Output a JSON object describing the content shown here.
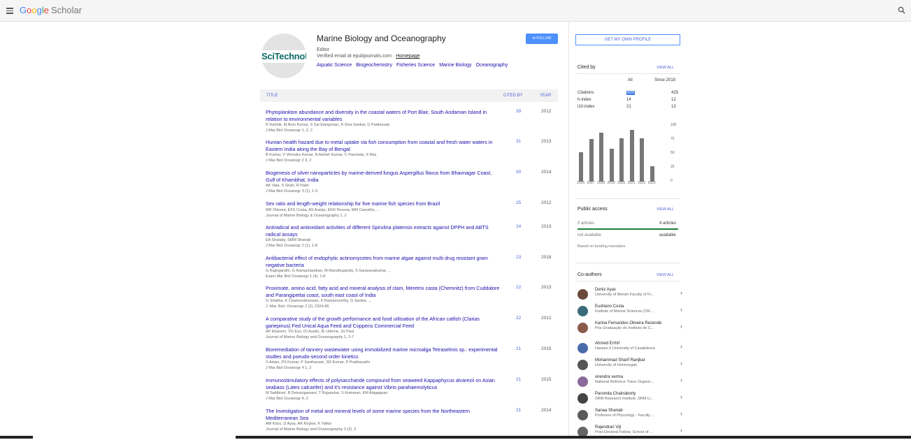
{
  "header": {
    "brand1": "G",
    "brand2": "o",
    "brand3": "o",
    "brand4": "g",
    "brand5": "l",
    "brand6": "e",
    "brand_suffix": "Scholar"
  },
  "profile": {
    "logo_text": "SciTechnol",
    "name": "Marine Biology and Oceanography",
    "role": "Editor",
    "email": "Verified email at epubjournals.com",
    "homepage": "Homepage",
    "tags": [
      "Aquatic Science",
      "Biogeochemistry",
      "Fisheries Science",
      "Marine Biology",
      "Oceanography"
    ],
    "follow_label": "FOLLOW"
  },
  "table": {
    "headers": {
      "title": "TITLE",
      "cited_by": "CITED BY",
      "year": "YEAR"
    },
    "rows": [
      {
        "title": "Phytoplankton abundance and diversity in the coastal waters of Port Blair, South Andaman Island in relation to environmental variables",
        "authors": "R Karthik, M Arun Kumar, S Sai Elangovan, R Siva Sankar, G Padmavati",
        "journal": "J Mar Biol Oceanogr 1, 2, 2",
        "cited": "39",
        "year": "2012"
      },
      {
        "title": "Human health hazard due to metal uptake via fish consumption from coastal and fresh water waters in Eastern India along the Bay of Bengal",
        "authors": "B Kumar, V Virendra Kumar, N Ashish Kumar, C Paromita, S Rita",
        "journal": "J Mar Biol Oceanogr 2 3, 2",
        "cited": "31",
        "year": "2013"
      },
      {
        "title": "Biogenesis of silver nanoparticles by marine-derived fungus Aspergillus flavus from Bhavnagar Coast, Gulf of Khambhat, India",
        "authors": "AK Vala, S Shah, R Patel",
        "journal": "J Mar Biol Oceanogr 3 (1), 1-3",
        "cited": "30",
        "year": "2014"
      },
      {
        "title": "Sex ratio and length-weight relationship for five marine fish species from Brazil",
        "authors": "MR Oliveira, EFS Costa, AS Araújo, EKR Pessoa, MM Carvalho, ...",
        "journal": "Journal of Marine Biology & Oceanography 1, 2",
        "cited": "25",
        "year": "2012"
      },
      {
        "title": "Antiradical and antioxidant activities of different Spirulina platensis extracts against DPPH and ABTS radical assays",
        "authors": "EA Shalaby, SMM Shanab",
        "journal": "J Mar Biol Oceanogr 2 (1), 1-8",
        "cited": "24",
        "year": "2013"
      },
      {
        "title": "Antibacterial effect of endophytic actinomycetes from marine algae against multi drug resistant gram negative bacteria",
        "authors": "G Rajivgandhi, G Ramachandran, M Maruthupandy, S Saravanakumar, ...",
        "journal": "Exam Mar Biol Oceanogr 1 (4), 1-8",
        "cited": "23",
        "year": "2018"
      },
      {
        "title": "Proximate, amino acid, fatty acid and mineral analysis of clam, Meretrix casta (Chemnitz) from Cuddalore and Parangipettai coast, south east coast of India",
        "authors": "G Srilatha, K Chamundeeswari, K Ramamoorthy, G Sankar, ...",
        "journal": "J. Mar. Biol. Oceanogr 2 (2), 2324-86",
        "cited": "22",
        "year": "2013"
      },
      {
        "title": "A comparative study of the growth performance and food utilisation of the African catfish (Clarias gariepinus) Fed Unical Aqua Feed and Coppens Commercial Feed",
        "authors": "AP Ekanem, VO Eyo, IO Austin, IE Udeme, JU Paul",
        "journal": "Journal of Marine Biology and Oceanography 1, 2-7",
        "cited": "22",
        "year": "2012"
      },
      {
        "title": "Bioremediation of tannery wastewater using immobilized marine microalga Tetraselmis sp.: experimental studies and pseudo-second order kinetics",
        "authors": "S Adam, PS Kumar, P Santhanam, SD Kumar, P Prabhavathi",
        "journal": "J Mar Biol Oceanogr 4 1, 2",
        "cited": "21",
        "year": "2015"
      },
      {
        "title": "Immunostimulatory effects of polysaccharide compound from seaweed Kappaphycus alvarezii on Asian seabass (Lates calcarifer) and it's resistance against Vibrio parahaemolyticus",
        "authors": "M Sakthivel, B Deivasigamani, T Rajasekar, S Kumaran, KM Alagappan",
        "journal": "J Mar Biol Oceanogr 4, 2",
        "cited": "21",
        "year": "2015"
      },
      {
        "title": "The Investigation of metal and mineral levels of some marine species from the Northeastern Mediterranean Sea",
        "authors": "AM Kücü, D Ayas, AR Köşker, K Yatkin",
        "journal": "Journal of Marine Biology and Oceanography 3 (2), 2",
        "cited": "21",
        "year": "2014"
      }
    ]
  },
  "sidebar": {
    "get_profile": "GET MY OWN PROFILE",
    "cited_by": "Cited by",
    "view_all": "VIEW ALL",
    "col_all": "All",
    "col_since": "Since 2018",
    "stats": [
      {
        "label": "Citations",
        "all": "600",
        "since": "425"
      },
      {
        "label": "h-index",
        "all": "14",
        "since": "12"
      },
      {
        "label": "i10-index",
        "all": "21",
        "since": "13"
      }
    ],
    "public_access": "Public access",
    "not_available_count": "0 articles",
    "available_count": "4 articles",
    "not_available": "not available",
    "available": "available",
    "funding": "Based on funding mandates",
    "coauthors_title": "Co-authors",
    "coauthors": [
      {
        "name": "Deniz Ayas",
        "aff": "University of Mersin Faculty of Fi..."
      },
      {
        "name": "Eudriano Costa",
        "aff": "Institute of Marine Sciences (OK..."
      },
      {
        "name": "Karina Fernandes Oliveira Rezende",
        "aff": "Pós Graduação do Instituto de C..."
      },
      {
        "name": "Ahmed Errhif",
        "aff": "Hassan II University of Casablanca"
      },
      {
        "name": "Mohammad Sharif Ranjbar",
        "aff": "University of Hormozgan"
      },
      {
        "name": "virendra verma",
        "aff": "National Refrence Trace Organic..."
      },
      {
        "name": "Paromita Chakraborty",
        "aff": "SRM Research Institute, SRM U..."
      },
      {
        "name": "Sanaa Shanab",
        "aff": "Professor of Phycology - Faculty ..."
      },
      {
        "name": "Rajendran Viji",
        "aff": "Post-Doctoral Fellow, School of ..."
      }
    ]
  },
  "chart_data": {
    "type": "bar",
    "categories": [
      "2016",
      "2017",
      "2018",
      "2019",
      "2020",
      "2021",
      "2022",
      "2023"
    ],
    "values": [
      52,
      76,
      88,
      59,
      77,
      92,
      78,
      27
    ],
    "ylim": [
      0,
      100
    ],
    "yticks": [
      "100",
      "75",
      "50",
      "25",
      "0"
    ]
  }
}
